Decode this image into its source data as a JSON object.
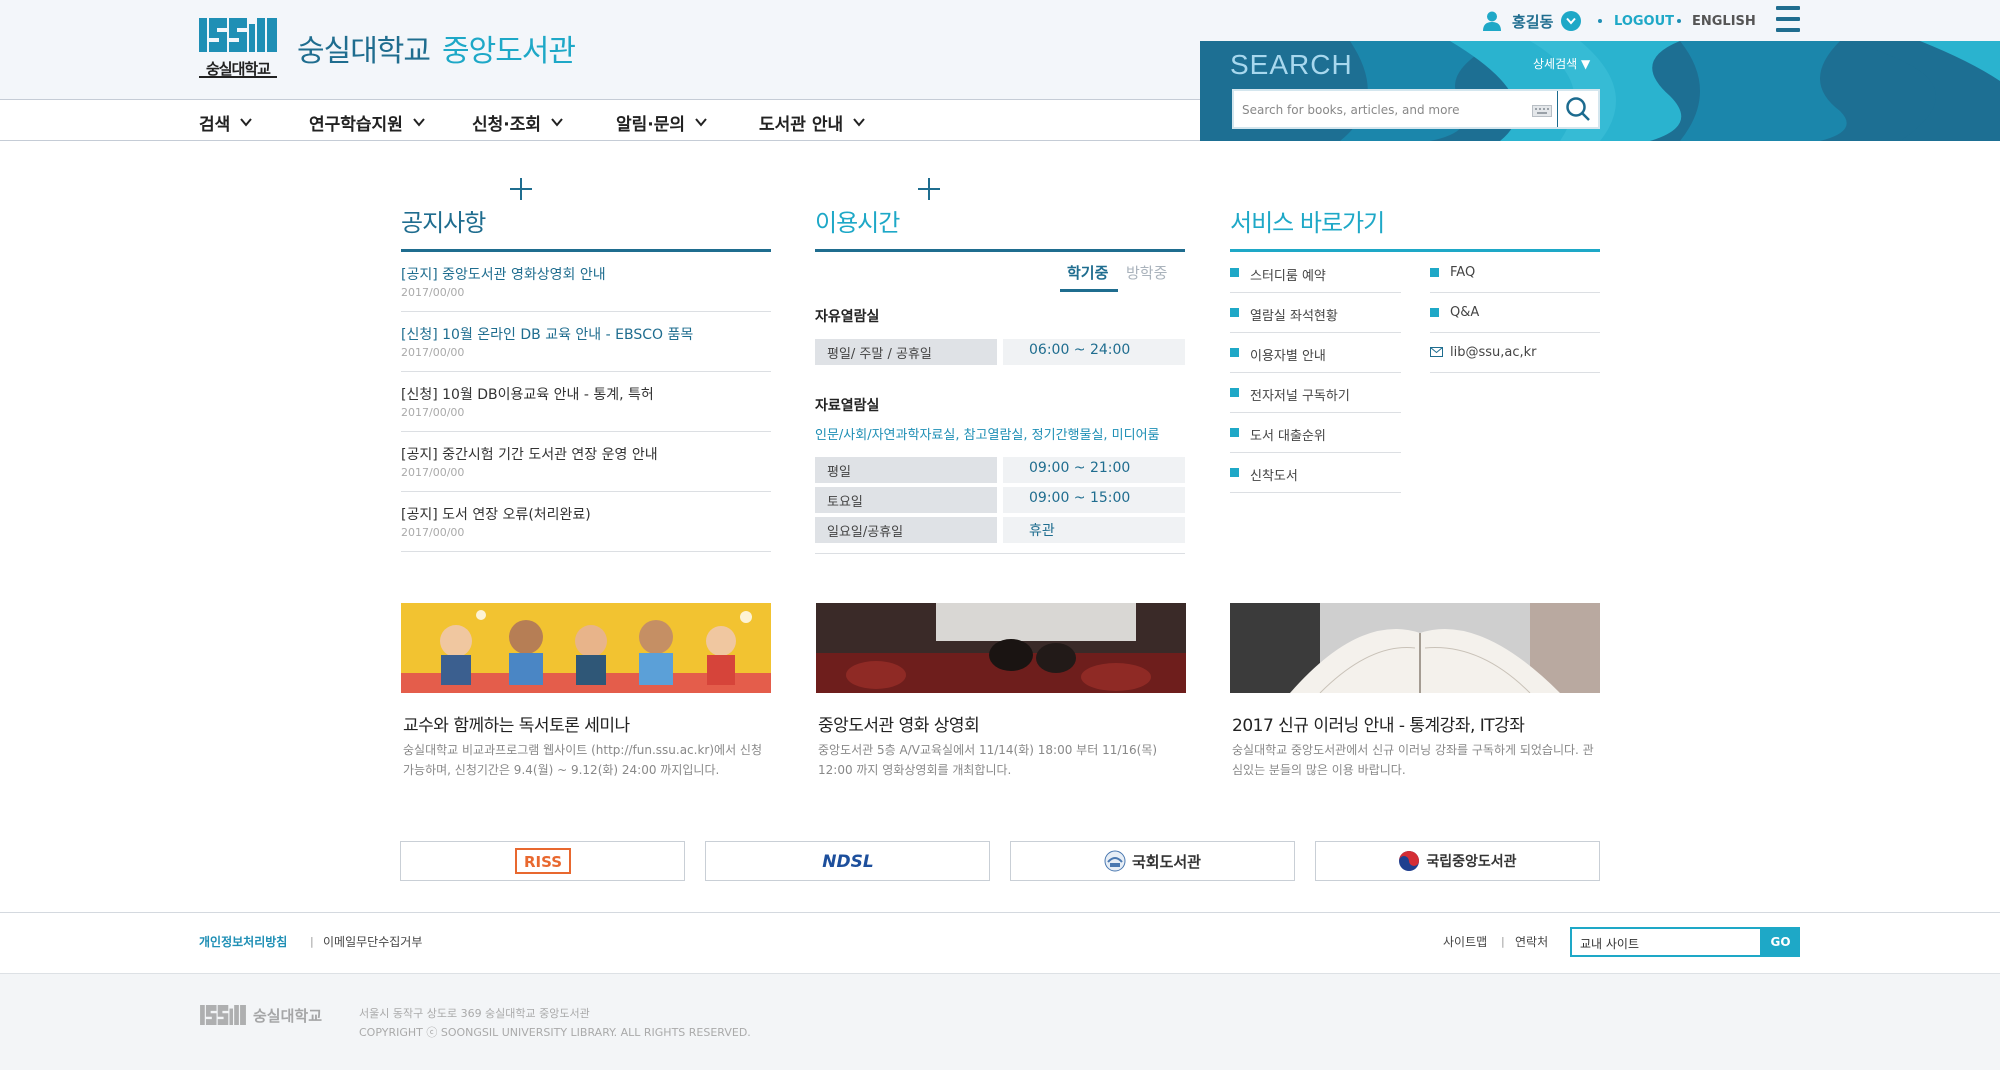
{
  "header": {
    "logo_text": "숭실대학교",
    "title_univ": "숭실대학교",
    "title_lib": "중앙도서관",
    "user_name": "홍길동",
    "logout": "LOGOUT",
    "english": "ENGLISH"
  },
  "nav": [
    {
      "label": "검색"
    },
    {
      "label": "연구학습지원"
    },
    {
      "label": "신청·조회"
    },
    {
      "label": "알림·문의"
    },
    {
      "label": "도서관 안내"
    }
  ],
  "search": {
    "title": "SEARCH",
    "advanced": "상세검색 ▼",
    "placeholder": "Search for books, articles, and more"
  },
  "notices": {
    "title": "공지사항",
    "items": [
      {
        "title": "[공지] 중앙도서관 영화상영회 안내",
        "date": "2017/00/00",
        "highlight": true
      },
      {
        "title": "[신청] 10월 온라인 DB 교육 안내 - EBSCO 품목",
        "date": "2017/00/00",
        "highlight": true
      },
      {
        "title": "[신청] 10월 DB이용교육 안내 - 통계, 특허",
        "date": "2017/00/00",
        "highlight": false
      },
      {
        "title": "[공지] 중간시험 기간 도서관 연장 운영 안내",
        "date": "2017/00/00",
        "highlight": false
      },
      {
        "title": "[공지] 도서 연장 오류(처리완료)",
        "date": "2017/00/00",
        "highlight": false
      }
    ]
  },
  "hours": {
    "title": "이용시간",
    "tabs": [
      "학기중",
      "방학중"
    ],
    "free_room": {
      "label": "자유열람실",
      "rows": [
        {
          "day": "평일/ 주말 / 공휴일",
          "time": "06:00 ~ 24:00"
        }
      ]
    },
    "reading_room": {
      "label": "자료열람실",
      "sub": "인문/사회/자연과학자료실, 참고열람실, 정기간행물실, 미디어룸",
      "rows": [
        {
          "day": "평일",
          "time": "09:00 ~ 21:00"
        },
        {
          "day": "토요일",
          "time": "09:00 ~ 15:00"
        },
        {
          "day": "일요일/공휴일",
          "time": "휴관"
        }
      ]
    }
  },
  "services": {
    "title": "서비스 바로가기",
    "left": [
      "스터디룸 예약",
      "열람실 좌석현황",
      "이용자별 안내",
      "전자저널 구독하기",
      "도서 대출순위",
      "신착도서"
    ],
    "right": [
      "FAQ",
      "Q&A",
      "lib@ssu,ac,kr"
    ]
  },
  "cards": [
    {
      "title": "교수와 함께하는 독서토론 세미나",
      "desc": "숭실대학교 비교과프로그램 웹사이트 (http://fun.ssu.ac.kr)에서 신청가능하며, 신청기간은 9.4(월) ~ 9.12(화) 24:00 까지입니다."
    },
    {
      "title": "중앙도서관 영화 상영회",
      "desc": "중앙도서관 5층 A/V교육실에서 11/14(화) 18:00 부터 11/16(목) 12:00 까지 영화상영회를 개최합니다."
    },
    {
      "title": "2017 신규 이러닝 안내 - 통계강좌, IT강좌",
      "desc": "숭실대학교 중앙도서관에서 신규 이러닝 강좌를 구독하게 되었습니다. 관심있는 분들의 많은 이용 바랍니다."
    }
  ],
  "banners": [
    "RISS",
    "NDSL",
    "국회도서관",
    "국립중앙도서관"
  ],
  "footer": {
    "privacy": "개인정보처리방침",
    "email_policy": "이메일무단수집거부",
    "sitemap": "사이트맵",
    "contact": "연락처",
    "site_select": "교내 사이트",
    "go": "GO",
    "logo_text": "숭실대학교",
    "address": "서울시 동작구 상도로 369  숭실대학교 중앙도서관",
    "copyright": "COPYRIGHT  ⓒ  SOONGSIL UNIVERSITY LIBRARY. ALL RIGHTS RESERVED."
  },
  "colors": {
    "primary": "#1f6d8f",
    "accent": "#1ea8c7",
    "search_bg": "#1c6b8f"
  }
}
